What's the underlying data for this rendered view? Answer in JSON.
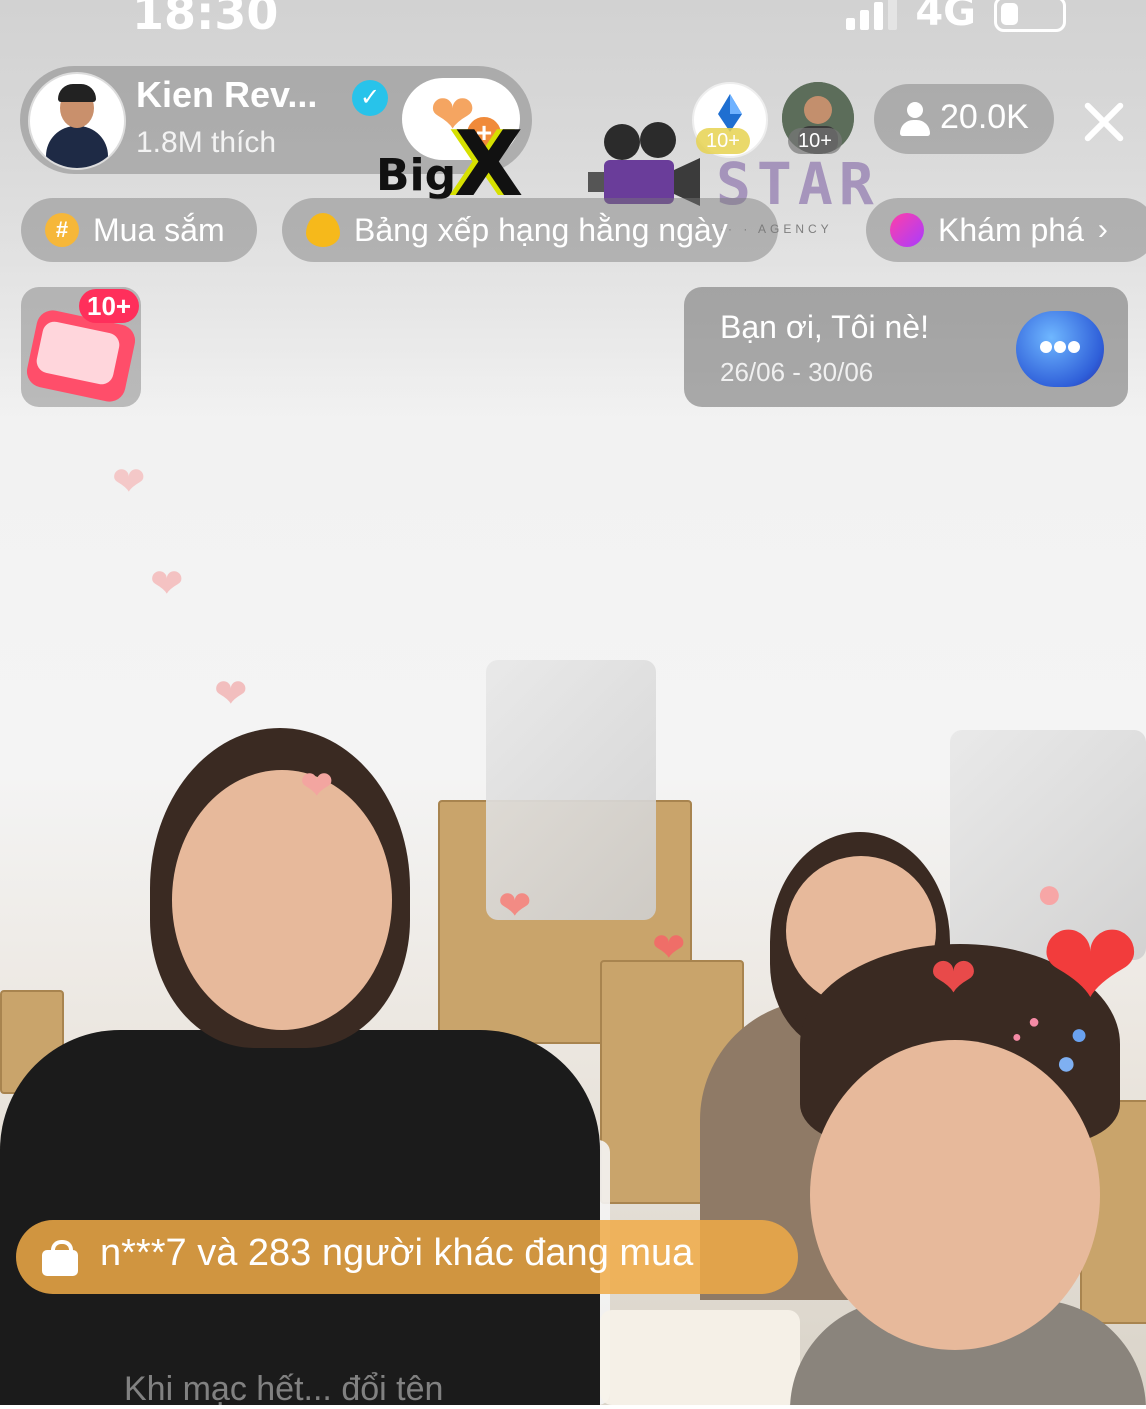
{
  "status_bar": {
    "time": "18:30",
    "network": "4G",
    "signal_bars": 3,
    "battery_level": 0.3
  },
  "host": {
    "name": "Kien Rev...",
    "likes": "1.8M thích",
    "verified": true,
    "follow_icon": "heart-plus-icon"
  },
  "watermark": {
    "big_text": "Big",
    "x_text": "X",
    "star_text": "STAR",
    "sub_text": "·· · AGENCY"
  },
  "top_viewers": [
    {
      "badge": "10+"
    },
    {
      "badge": "10+"
    }
  ],
  "viewer_count": "20.0K",
  "chips": [
    {
      "icon": "hashtag-icon",
      "label": "Mua sắm"
    },
    {
      "icon": "flame-icon",
      "label": "Bảng xếp hạng hằng ngày"
    },
    {
      "icon": "planet-icon",
      "label": "Khám phá",
      "chevron": "›"
    }
  ],
  "gift": {
    "badge": "10+"
  },
  "promo": {
    "title": "Bạn ơi, Tôi nè!",
    "date": "26/06 - 30/06",
    "icon": "chat-bubble-icon"
  },
  "purchase_banner": {
    "icon": "shopping-bag-icon",
    "text": "n***7 và 283 người khác đang mua"
  },
  "comment_ghost": "Khi mạc hết... đổi tên",
  "colors": {
    "overlay": "#7a7a7a",
    "accent_orange": "#f0aa46",
    "badge_red": "#ff2f5b",
    "verified_blue": "#28c3ea",
    "heart": "#f26a6a"
  }
}
